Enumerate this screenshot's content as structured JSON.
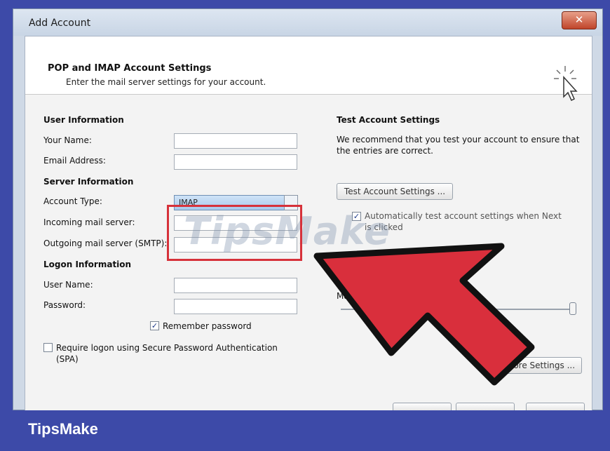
{
  "window": {
    "title": "Add Account",
    "close_glyph": "✕"
  },
  "header": {
    "title": "POP and IMAP Account Settings",
    "subtitle": "Enter the mail server settings for your account."
  },
  "left": {
    "user_info_heading": "User Information",
    "your_name_label": "Your Name:",
    "email_label": "Email Address:",
    "server_info_heading": "Server Information",
    "account_type_label": "Account Type:",
    "account_type_value": "IMAP",
    "incoming_label": "Incoming mail server:",
    "outgoing_label": "Outgoing mail server (SMTP):",
    "logon_heading": "Logon Information",
    "username_label": "User Name:",
    "password_label": "Password:",
    "remember_label": "Remember password",
    "spa_label": "Require logon using Secure Password Authentication (SPA)"
  },
  "right": {
    "test_heading": "Test Account Settings",
    "test_desc": "We recommend that you test your account to ensure that the entries are correct.",
    "test_button": "Test Account Settings ...",
    "auto_test_label": "Automatically test account settings when Next is clicked",
    "ma_label": "Ma",
    "more_settings_button": "More Settings ..."
  },
  "overlay": {
    "watermark": "TipsMake"
  },
  "footer": {
    "brand": "TipsMake"
  },
  "colors": {
    "highlight": "#d6313a",
    "arrow": "#d92f3c",
    "brand_band": "#3d4aa8"
  }
}
